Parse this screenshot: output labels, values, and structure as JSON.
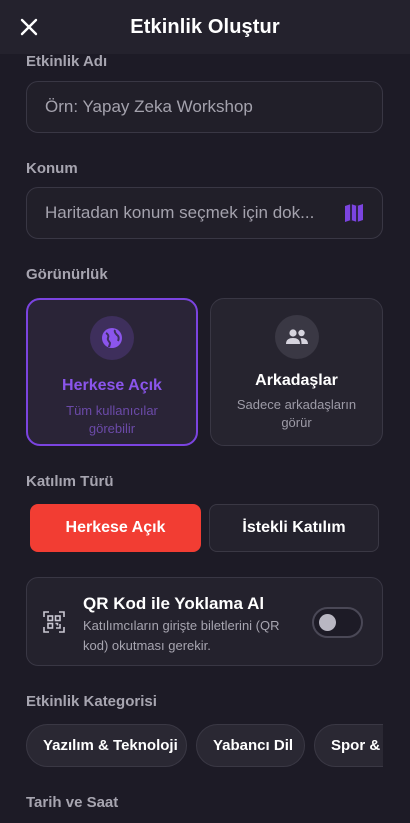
{
  "header": {
    "title": "Etkinlik Oluştur",
    "close_icon": "close-icon"
  },
  "event_name": {
    "label": "Etkinlik Adı",
    "placeholder": "Örn: Yapay Zeka Workshop",
    "value": ""
  },
  "location": {
    "label": "Konum",
    "placeholder": "Haritadan konum seçmek için dok...",
    "value": "",
    "icon": "map-icon"
  },
  "visibility": {
    "label": "Görünürlük",
    "options": [
      {
        "title": "Herkese Açık",
        "subtitle": "Tüm kullanıcılar görebilir",
        "icon": "globe-icon",
        "selected": true
      },
      {
        "title": "Arkadaşlar",
        "subtitle": "Sadece arkadaşların görür",
        "icon": "people-icon",
        "selected": false
      }
    ]
  },
  "join_type": {
    "label": "Katılım Türü",
    "options": [
      {
        "label": "Herkese Açık",
        "selected": true
      },
      {
        "label": "İstekli Katılım",
        "selected": false
      }
    ]
  },
  "qr_attendance": {
    "title": "QR Kod ile Yoklama Al",
    "description": "Katılımcıların girişte biletlerini (QR kod) okutması gerekir.",
    "enabled": false,
    "icon": "qr-scan-icon"
  },
  "category": {
    "label": "Etkinlik Kategorisi",
    "chips": [
      "Yazılım & Teknoloji",
      "Yabancı Dil",
      "Spor & G"
    ]
  },
  "datetime": {
    "label": "Tarih ve Saat"
  },
  "colors": {
    "background": "#1d1b26",
    "accent_purple": "#7b44e0",
    "accent_red": "#f23d33"
  }
}
